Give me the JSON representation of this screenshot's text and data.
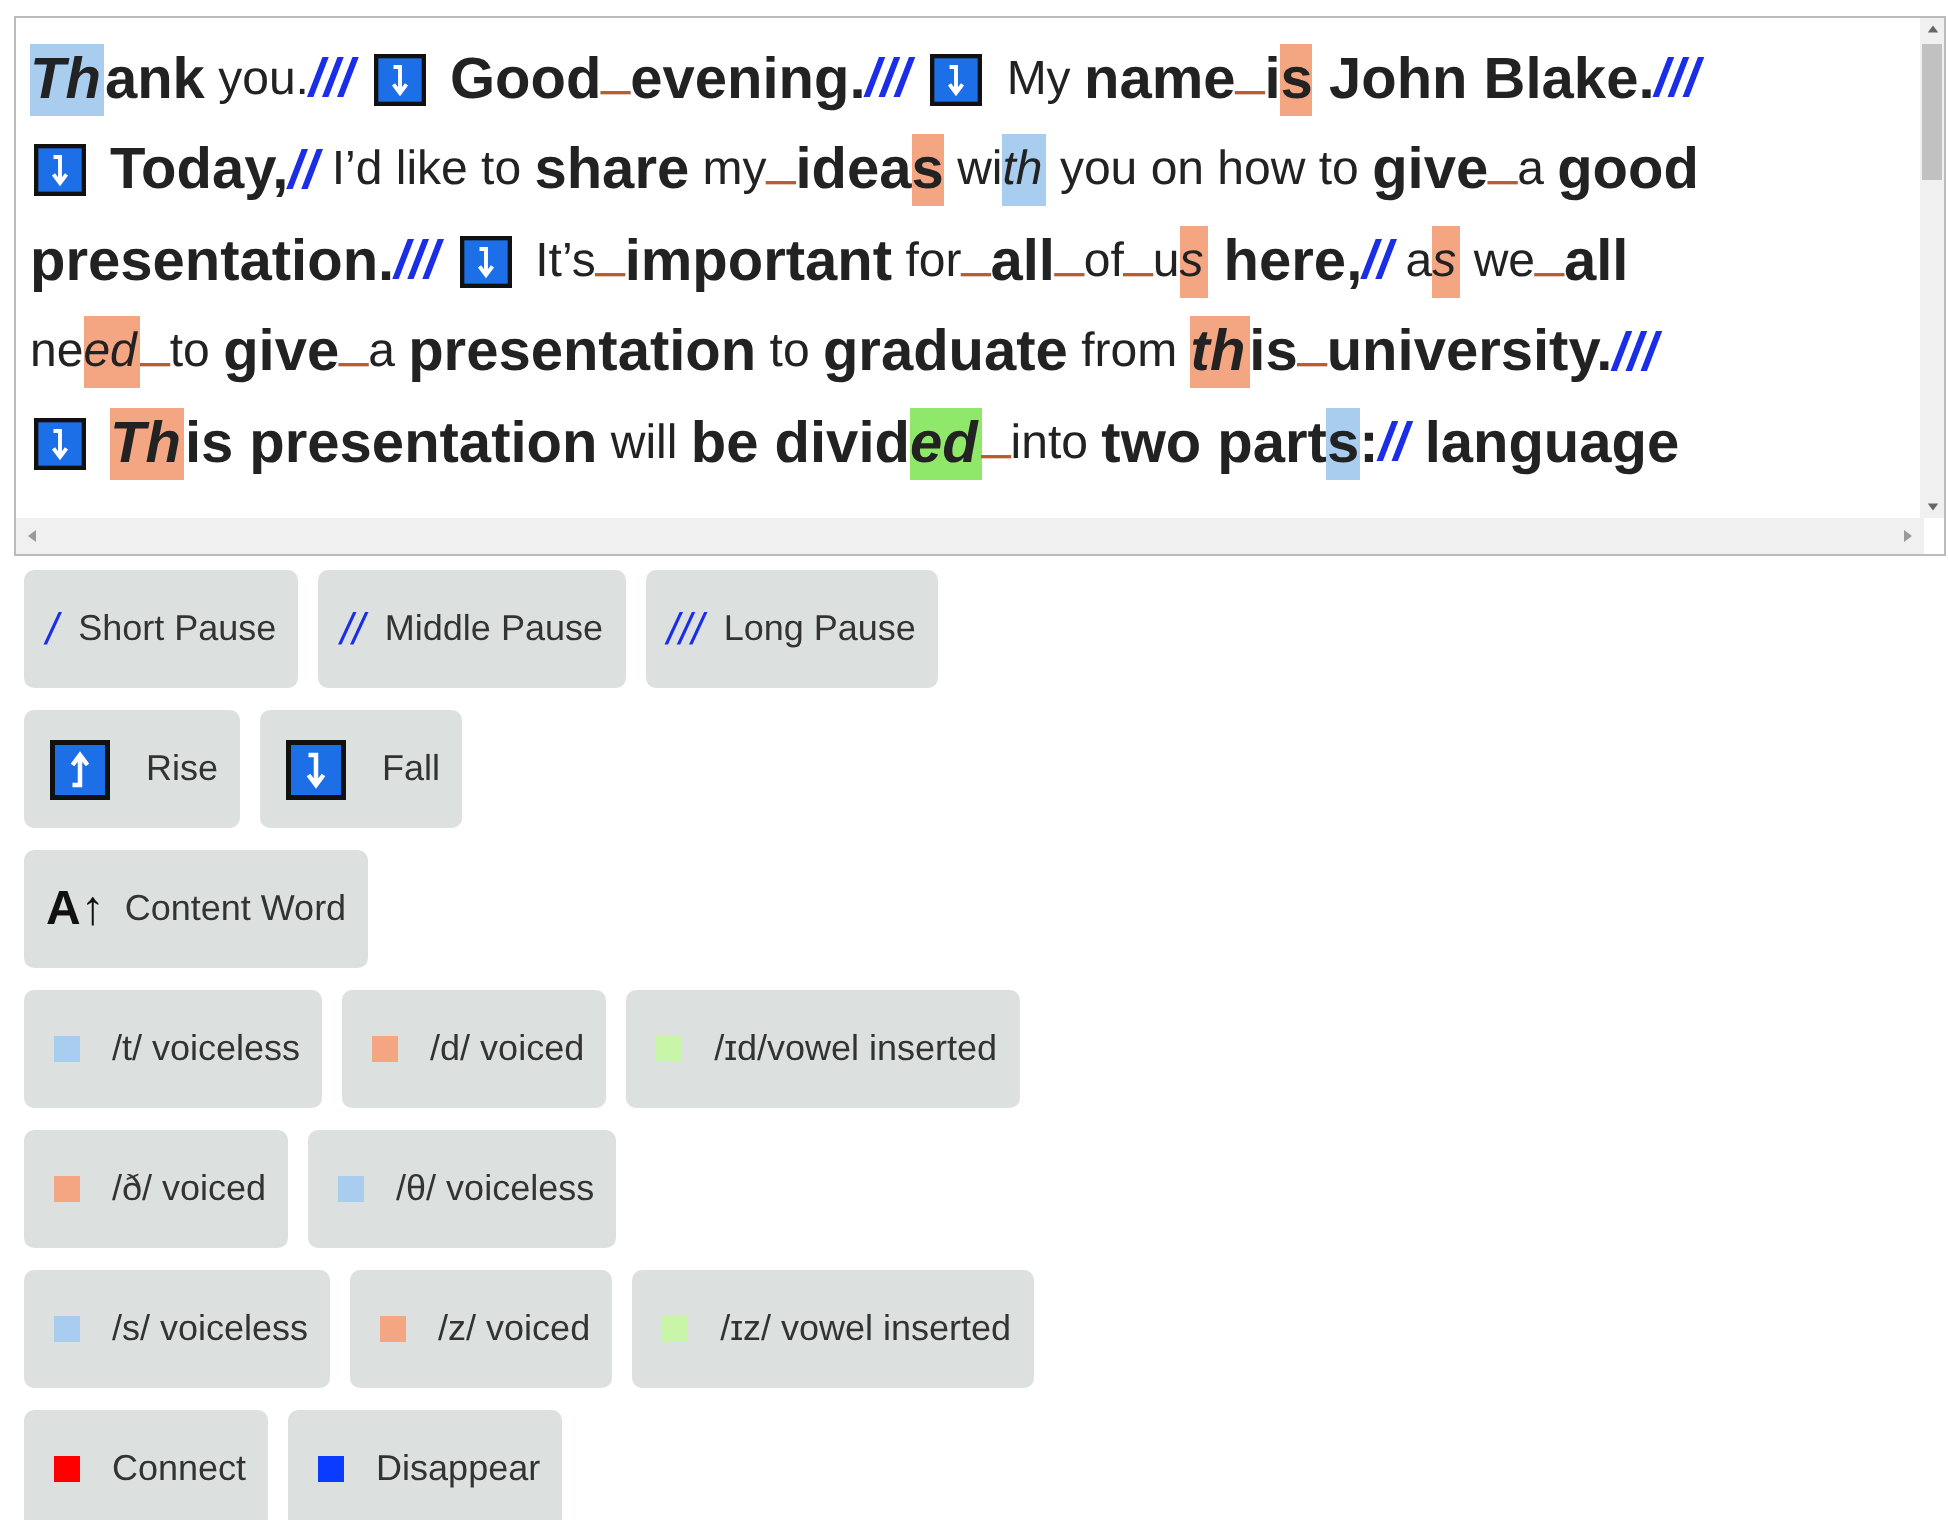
{
  "passage": {
    "lines": [
      [
        {
          "kind": "word",
          "text": "Th",
          "bold": true,
          "italic": true,
          "color": "#a9cdef"
        },
        {
          "kind": "word",
          "text": "ank",
          "bold": true,
          "italic": false
        },
        {
          "kind": "word",
          "text": " you.",
          "bold": false,
          "italic": false
        },
        {
          "kind": "pause",
          "text": "///"
        },
        {
          "kind": "fall"
        },
        {
          "kind": "word",
          "text": "Good",
          "bold": true,
          "italic": false
        },
        {
          "kind": "link",
          "text": "_"
        },
        {
          "kind": "word",
          "text": "evening.",
          "bold": true,
          "italic": false
        },
        {
          "kind": "pause",
          "text": "///"
        },
        {
          "kind": "fall"
        },
        {
          "kind": "word",
          "text": "My ",
          "bold": false,
          "italic": false
        },
        {
          "kind": "word",
          "text": "name",
          "bold": true,
          "italic": false
        },
        {
          "kind": "link",
          "text": "_"
        },
        {
          "kind": "word",
          "text": "i",
          "bold": true,
          "italic": false
        },
        {
          "kind": "word",
          "text": "s",
          "bold": true,
          "italic": false,
          "color": "#f4a582"
        },
        {
          "kind": "word",
          "text": " John Blake.",
          "bold": true,
          "italic": false
        },
        {
          "kind": "pause",
          "text": "///"
        }
      ],
      [
        {
          "kind": "fall"
        },
        {
          "kind": "word",
          "text": "Today,",
          "bold": true,
          "italic": false
        },
        {
          "kind": "pause",
          "text": "//"
        },
        {
          "kind": "word",
          "text": " I’d like to ",
          "bold": false,
          "italic": false
        },
        {
          "kind": "word",
          "text": "share",
          "bold": true,
          "italic": false
        },
        {
          "kind": "word",
          "text": " my",
          "bold": false,
          "italic": false
        },
        {
          "kind": "link",
          "text": "_"
        },
        {
          "kind": "word",
          "text": "idea",
          "bold": true,
          "italic": false
        },
        {
          "kind": "word",
          "text": "s",
          "bold": true,
          "italic": false,
          "color": "#f4a582"
        },
        {
          "kind": "word",
          "text": " wi",
          "bold": false,
          "italic": false
        },
        {
          "kind": "word",
          "text": "th",
          "bold": false,
          "italic": true,
          "color": "#a9cdef"
        },
        {
          "kind": "word",
          "text": " you on how to ",
          "bold": false,
          "italic": false
        },
        {
          "kind": "word",
          "text": "give",
          "bold": true,
          "italic": false
        },
        {
          "kind": "link",
          "text": "_"
        },
        {
          "kind": "word",
          "text": "a ",
          "bold": false,
          "italic": false
        },
        {
          "kind": "word",
          "text": "good",
          "bold": true,
          "italic": false
        }
      ],
      [
        {
          "kind": "word",
          "text": "presentation.",
          "bold": true,
          "italic": false
        },
        {
          "kind": "pause",
          "text": "///"
        },
        {
          "kind": "fall"
        },
        {
          "kind": "word",
          "text": "It’s",
          "bold": false,
          "italic": false
        },
        {
          "kind": "link",
          "text": "_"
        },
        {
          "kind": "word",
          "text": "important",
          "bold": true,
          "italic": false
        },
        {
          "kind": "word",
          "text": " for",
          "bold": false,
          "italic": false
        },
        {
          "kind": "link",
          "text": "_"
        },
        {
          "kind": "word",
          "text": "all",
          "bold": true,
          "italic": false
        },
        {
          "kind": "link",
          "text": "_"
        },
        {
          "kind": "word",
          "text": "of",
          "bold": false,
          "italic": false
        },
        {
          "kind": "link",
          "text": "_"
        },
        {
          "kind": "word",
          "text": "u",
          "bold": false,
          "italic": false
        },
        {
          "kind": "word",
          "text": "s",
          "bold": false,
          "italic": true,
          "color": "#f4a582"
        },
        {
          "kind": "word",
          "text": " here,",
          "bold": true,
          "italic": false
        },
        {
          "kind": "pause",
          "text": "//"
        },
        {
          "kind": "word",
          "text": " a",
          "bold": false,
          "italic": false
        },
        {
          "kind": "word",
          "text": "s",
          "bold": false,
          "italic": true,
          "color": "#f4a582"
        },
        {
          "kind": "word",
          "text": " we",
          "bold": false,
          "italic": false
        },
        {
          "kind": "link",
          "text": "_"
        },
        {
          "kind": "word",
          "text": "all",
          "bold": true,
          "italic": false
        }
      ],
      [
        {
          "kind": "word",
          "text": "ne",
          "bold": false,
          "italic": false
        },
        {
          "kind": "word",
          "text": "ed",
          "bold": false,
          "italic": true,
          "color": "#f4a582"
        },
        {
          "kind": "link",
          "text": "_"
        },
        {
          "kind": "word",
          "text": "to ",
          "bold": false,
          "italic": false
        },
        {
          "kind": "word",
          "text": "give",
          "bold": true,
          "italic": false
        },
        {
          "kind": "link",
          "text": "_"
        },
        {
          "kind": "word",
          "text": "a ",
          "bold": false,
          "italic": false
        },
        {
          "kind": "word",
          "text": "presentation",
          "bold": true,
          "italic": false
        },
        {
          "kind": "word",
          "text": " to ",
          "bold": false,
          "italic": false
        },
        {
          "kind": "word",
          "text": "graduate",
          "bold": true,
          "italic": false
        },
        {
          "kind": "word",
          "text": " from ",
          "bold": false,
          "italic": false
        },
        {
          "kind": "word",
          "text": "th",
          "bold": true,
          "italic": true,
          "color": "#f4a582"
        },
        {
          "kind": "word",
          "text": "is",
          "bold": true,
          "italic": false
        },
        {
          "kind": "link",
          "text": "_"
        },
        {
          "kind": "word",
          "text": "university.",
          "bold": true,
          "italic": false
        },
        {
          "kind": "pause",
          "text": "///"
        }
      ],
      [
        {
          "kind": "fall"
        },
        {
          "kind": "word",
          "text": "Th",
          "bold": true,
          "italic": true,
          "color": "#f4a582"
        },
        {
          "kind": "word",
          "text": "is presentation",
          "bold": true,
          "italic": false
        },
        {
          "kind": "word",
          "text": " will ",
          "bold": false,
          "italic": false
        },
        {
          "kind": "word",
          "text": "be divid",
          "bold": true,
          "italic": false
        },
        {
          "kind": "word",
          "text": "ed",
          "bold": true,
          "italic": true,
          "color": "#8fe86a"
        },
        {
          "kind": "link",
          "text": "_"
        },
        {
          "kind": "word",
          "text": "into ",
          "bold": false,
          "italic": false
        },
        {
          "kind": "word",
          "text": "two part",
          "bold": true,
          "italic": false
        },
        {
          "kind": "word",
          "text": "s",
          "bold": true,
          "italic": false,
          "color": "#a9cdef"
        },
        {
          "kind": "word",
          "text": ":",
          "bold": true,
          "italic": false
        },
        {
          "kind": "pause",
          "text": "//"
        },
        {
          "kind": "word",
          "text": " language",
          "bold": true,
          "italic": false
        }
      ]
    ]
  },
  "legend": [
    [
      {
        "kind": "pause",
        "symbol": "/",
        "label": "Short Pause"
      },
      {
        "kind": "pause",
        "symbol": "//",
        "label": "Middle Pause"
      },
      {
        "kind": "pause",
        "symbol": "///",
        "label": "Long Pause"
      }
    ],
    [
      {
        "kind": "rise",
        "label": "Rise"
      },
      {
        "kind": "fall",
        "label": "Fall"
      }
    ],
    [
      {
        "kind": "content",
        "symbol": "A↑",
        "label": "Content Word"
      }
    ],
    [
      {
        "kind": "swatch",
        "color": "#a9cdef",
        "label": "/t/ voiceless"
      },
      {
        "kind": "swatch",
        "color": "#f4a582",
        "label": "/d/ voiced"
      },
      {
        "kind": "swatch",
        "color": "#c8f5a8",
        "label": "/ɪd/vowel inserted"
      }
    ],
    [
      {
        "kind": "swatch",
        "color": "#f4a582",
        "label": "/ð/ voiced"
      },
      {
        "kind": "swatch",
        "color": "#a9cdef",
        "label": "/θ/ voiceless"
      }
    ],
    [
      {
        "kind": "swatch",
        "color": "#a9cdef",
        "label": "/s/ voiceless"
      },
      {
        "kind": "swatch",
        "color": "#f4a582",
        "label": "/z/ voiced"
      },
      {
        "kind": "swatch",
        "color": "#c8f5a8",
        "label": "/ɪz/ vowel inserted"
      }
    ],
    [
      {
        "kind": "swatch",
        "color": "#ff0000",
        "label": "Connect"
      },
      {
        "kind": "swatch",
        "color": "#0a3cff",
        "label": "Disappear"
      }
    ]
  ]
}
